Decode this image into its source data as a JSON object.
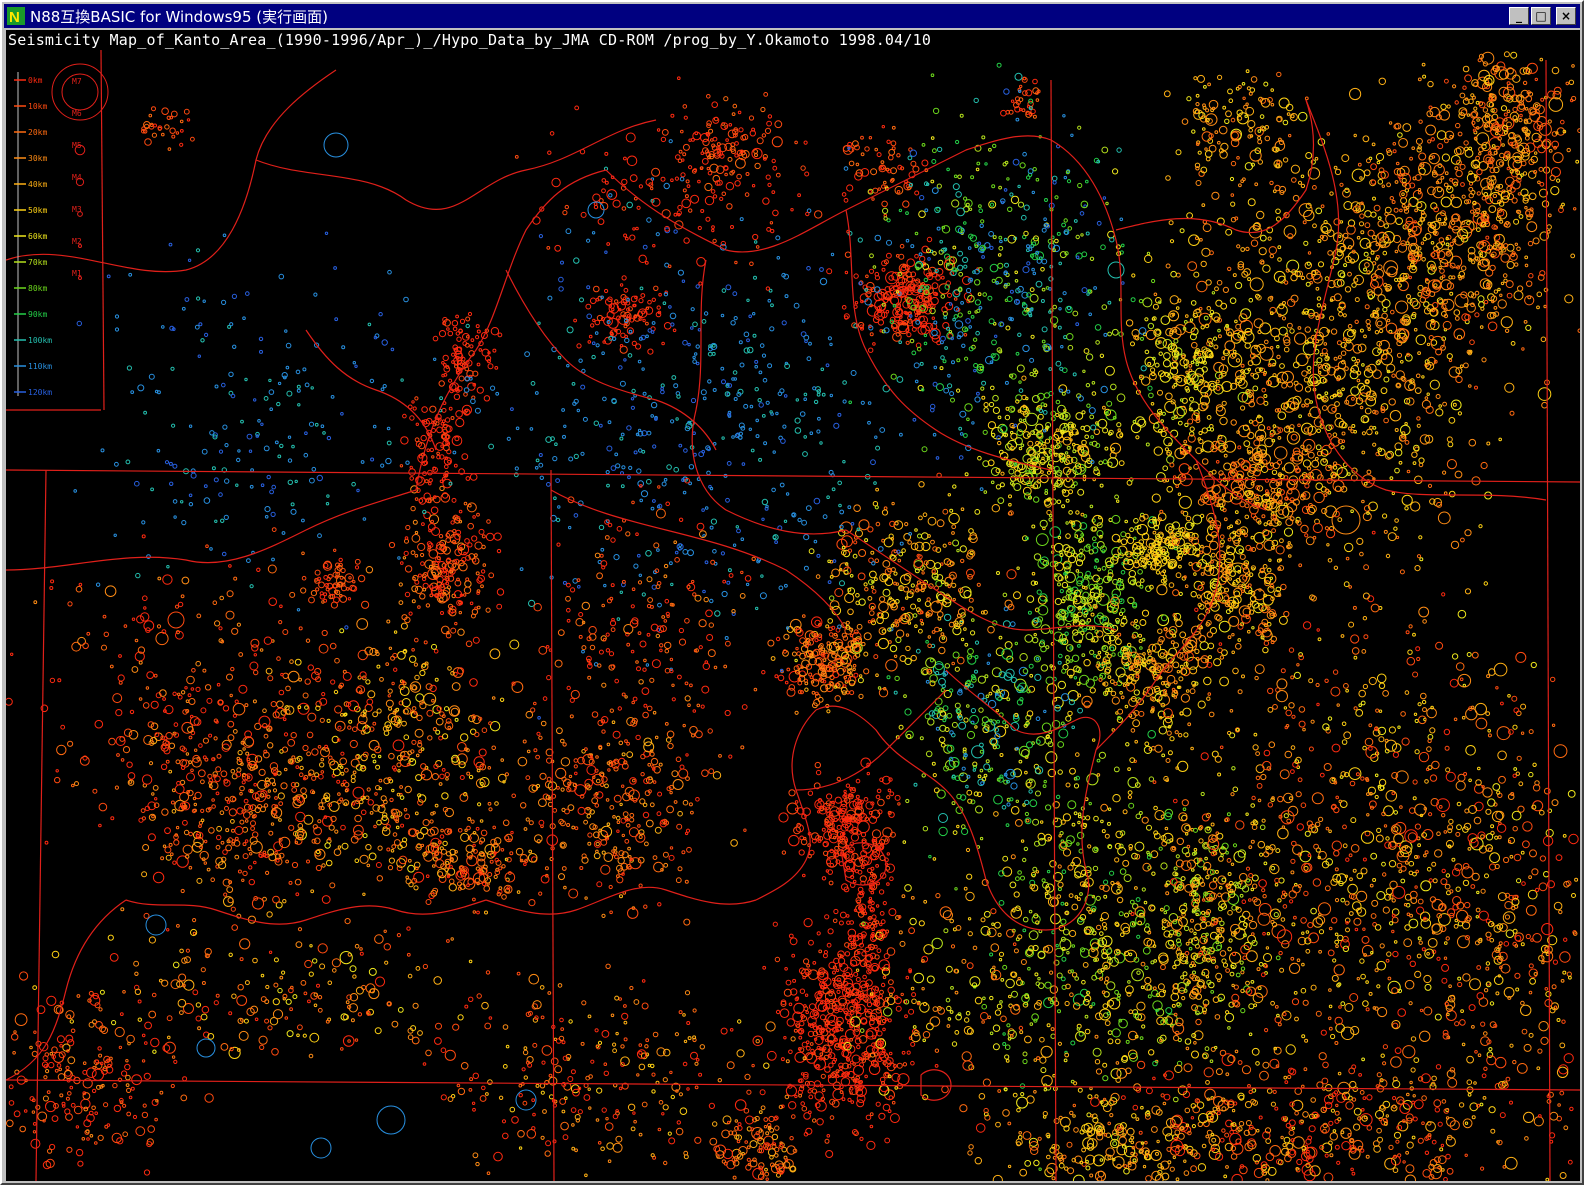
{
  "window": {
    "title": "N88互換BASIC for Windows95 (実行画面)",
    "app_icon": "n88-basic-icon",
    "controls": {
      "minimize": "_",
      "maximize": "□",
      "close": "×"
    }
  },
  "map": {
    "caption": "Seismicity Map_of_Kanto_Area_(1990-1996/Apr_)_/Hypo_Data_by_JMA CD-ROM /prog_by_Y.Okamoto 1998.04/10",
    "background": "#000000",
    "boundary_color": "#e0201a",
    "legend": {
      "depth_labels": [
        "0km",
        "10km",
        "20km",
        "30km",
        "40km",
        "50km",
        "60km",
        "70km",
        "80km",
        "90km",
        "100km",
        "110km",
        "120km"
      ],
      "magnitude_labels": [
        "M7",
        "M6",
        "M5",
        "M4",
        "M3",
        "M2",
        "M1"
      ],
      "depth_colors": [
        "#ff2a10",
        "#ff4a10",
        "#ff6a10",
        "#ff8c14",
        "#ffb014",
        "#ffd214",
        "#f0e81c",
        "#b4e01c",
        "#6cd81c",
        "#24d048",
        "#24c0b0",
        "#2890e0",
        "#2860e0"
      ]
    }
  }
}
